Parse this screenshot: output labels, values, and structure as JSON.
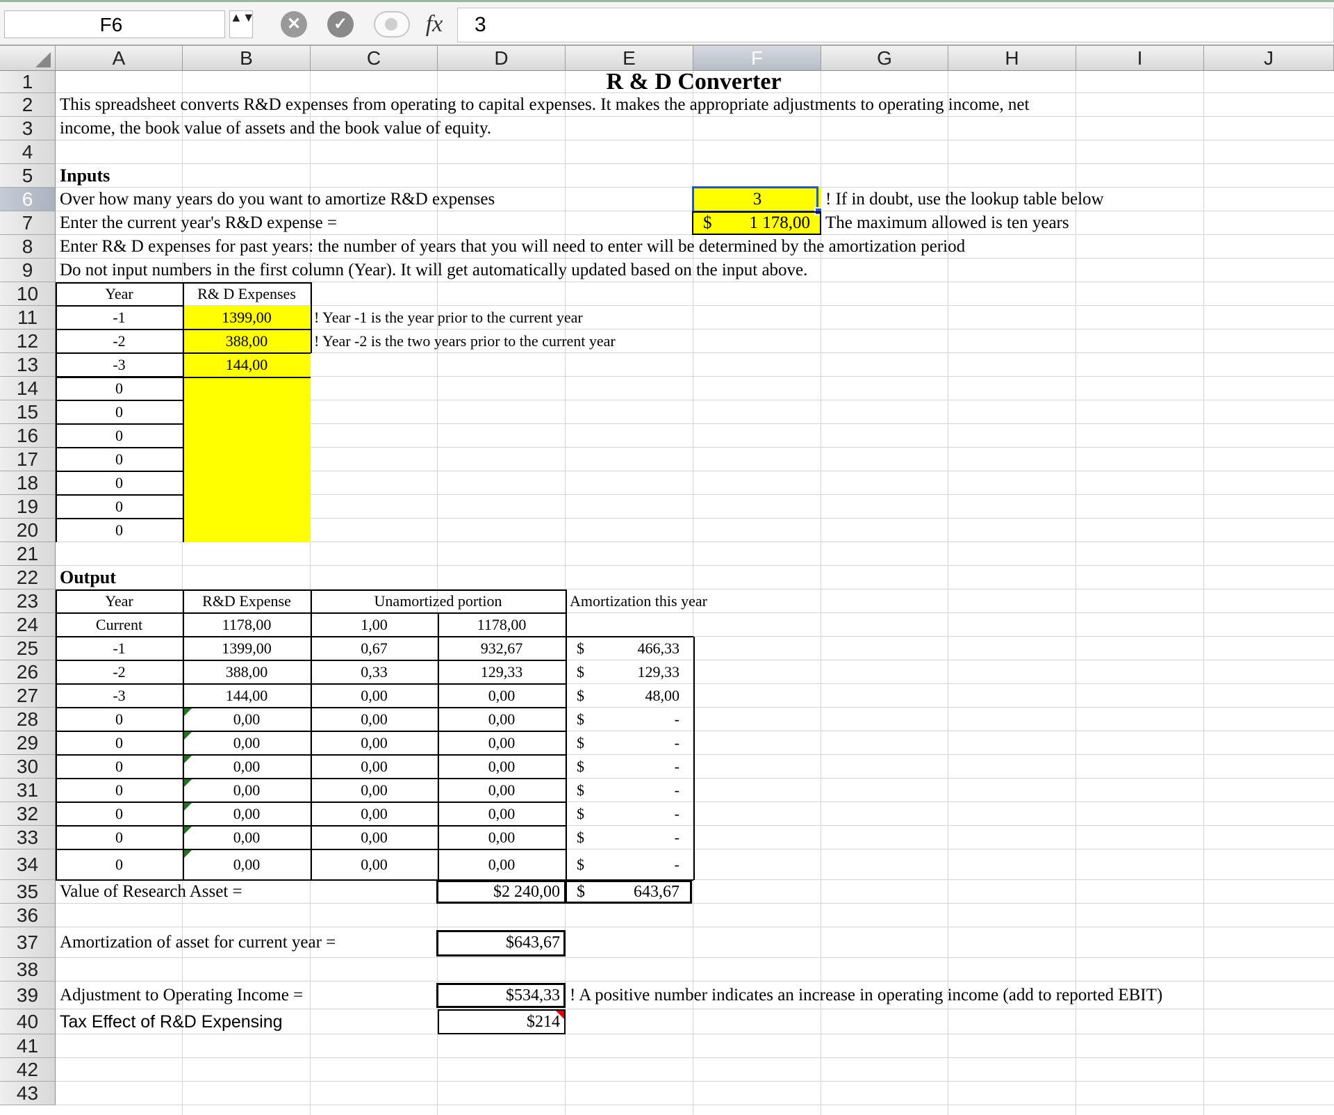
{
  "formula_bar": {
    "cell_ref": "F6",
    "stepper": "▲▼",
    "cancel_glyph": "✕",
    "accept_glyph": "✓",
    "fx_label": "fx",
    "value": "3"
  },
  "columns": [
    "A",
    "B",
    "C",
    "D",
    "E",
    "F",
    "G",
    "H",
    "I",
    "J"
  ],
  "rows": [
    "1",
    "2",
    "3",
    "4",
    "5",
    "6",
    "7",
    "8",
    "9",
    "10",
    "11",
    "12",
    "13",
    "14",
    "15",
    "16",
    "17",
    "18",
    "19",
    "20",
    "21",
    "22",
    "23",
    "24",
    "25",
    "26",
    "27",
    "28",
    "29",
    "30",
    "31",
    "32",
    "33",
    "34",
    "35",
    "36",
    "37",
    "38",
    "39",
    "40",
    "41",
    "42",
    "43"
  ],
  "sheet": {
    "title": "R & D Converter",
    "intro_line1": "This spreadsheet converts R&D expenses from operating to capital expenses. It makes the appropriate adjustments to operating income, net",
    "intro_line2": "income, the book value of assets and the book value of equity.",
    "inputs_heading": "Inputs",
    "amort_prompt": "Over how many years do you want to amortize R&D expenses",
    "amort_years": "3",
    "amort_note": "! If in doubt, use the lookup table below",
    "current_prompt": "Enter the current year's R&D expense =",
    "current_currency": "$",
    "current_value": "1 178,00",
    "current_note": "The maximum allowed is ten years",
    "past_prompt": "Enter R& D expenses for past years: the number of years that you will need to enter will be determined by the amortization period",
    "no_input_note": "Do not input numbers in the first column (Year). It will get automatically updated  based on the input above.",
    "input_table": {
      "col_year": "Year",
      "col_expenses": "R& D Expenses",
      "rows": [
        {
          "year": "-1",
          "value": "1399,00",
          "note": "! Year -1 is the year prior to the current year"
        },
        {
          "year": "-2",
          "value": "388,00",
          "note": "! Year -2 is the two years prior to the current year"
        },
        {
          "year": "-3",
          "value": "144,00",
          "note": ""
        },
        {
          "year": "0",
          "value": "",
          "note": ""
        },
        {
          "year": "0",
          "value": "",
          "note": ""
        },
        {
          "year": "0",
          "value": "",
          "note": ""
        },
        {
          "year": "0",
          "value": "",
          "note": ""
        },
        {
          "year": "0",
          "value": "",
          "note": ""
        },
        {
          "year": "0",
          "value": "",
          "note": ""
        },
        {
          "year": "0",
          "value": "",
          "note": ""
        }
      ]
    },
    "output_heading": "Output",
    "output_table": {
      "col_year": "Year",
      "col_expense": "R&D Expense",
      "col_unamortized": "Unamortized portion",
      "col_amortization": "Amortization this year",
      "rows": [
        {
          "year": "Current",
          "expense": "1178,00",
          "ratio": "1,00",
          "unamortized": "1178,00",
          "cur": "",
          "amort": ""
        },
        {
          "year": "-1",
          "expense": "1399,00",
          "ratio": "0,67",
          "unamortized": "932,67",
          "cur": "$",
          "amort": "466,33"
        },
        {
          "year": "-2",
          "expense": "388,00",
          "ratio": "0,33",
          "unamortized": "129,33",
          "cur": "$",
          "amort": "129,33"
        },
        {
          "year": "-3",
          "expense": "144,00",
          "ratio": "0,00",
          "unamortized": "0,00",
          "cur": "$",
          "amort": "48,00"
        },
        {
          "year": "0",
          "expense": "0,00",
          "ratio": "0,00",
          "unamortized": "0,00",
          "cur": "$",
          "amort": "-"
        },
        {
          "year": "0",
          "expense": "0,00",
          "ratio": "0,00",
          "unamortized": "0,00",
          "cur": "$",
          "amort": "-"
        },
        {
          "year": "0",
          "expense": "0,00",
          "ratio": "0,00",
          "unamortized": "0,00",
          "cur": "$",
          "amort": "-"
        },
        {
          "year": "0",
          "expense": "0,00",
          "ratio": "0,00",
          "unamortized": "0,00",
          "cur": "$",
          "amort": "-"
        },
        {
          "year": "0",
          "expense": "0,00",
          "ratio": "0,00",
          "unamortized": "0,00",
          "cur": "$",
          "amort": "-"
        },
        {
          "year": "0",
          "expense": "0,00",
          "ratio": "0,00",
          "unamortized": "0,00",
          "cur": "$",
          "amort": "-"
        },
        {
          "year": "0",
          "expense": "0,00",
          "ratio": "0,00",
          "unamortized": "0,00",
          "cur": "$",
          "amort": "-"
        }
      ]
    },
    "research_asset_label": "Value of Research Asset =",
    "research_asset_value": "$2 240,00",
    "research_asset_cur": "$",
    "research_asset_amort": "643,67",
    "amort_asset_label": "Amortization of asset for current year =",
    "amort_asset_value": "$643,67",
    "adj_label": "Adjustment to Operating Income =",
    "adj_value": "$534,33",
    "adj_note": "! A positive number indicates an increase in operating income (add to reported EBIT)",
    "tax_label": "Tax Effect of R&D Expensing",
    "tax_value": "$214"
  },
  "colors": {
    "input_fill": "#ffff00",
    "selection": "#2255cc",
    "cancel_button": "#9a9a9a",
    "accept_button": "#8a8a8a"
  }
}
